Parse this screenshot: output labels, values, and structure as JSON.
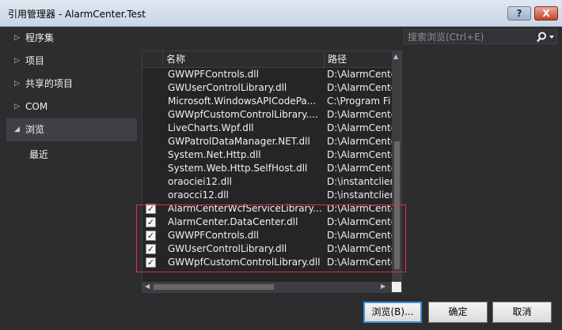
{
  "window": {
    "title": "引用管理器 - AlarmCenter.Test",
    "help_label": "?",
    "close_label": "X"
  },
  "nav": {
    "items": [
      {
        "label": "程序集",
        "arrow": "▷"
      },
      {
        "label": "项目",
        "arrow": "▷"
      },
      {
        "label": "共享的项目",
        "arrow": "▷"
      },
      {
        "label": "COM",
        "arrow": "▷"
      },
      {
        "label": "浏览",
        "arrow": "◢"
      }
    ],
    "sub_item": "最近"
  },
  "search": {
    "placeholder": "搜索浏览(Ctrl+E)",
    "icon": "search-icon"
  },
  "list": {
    "columns": [
      "名称",
      "路径"
    ],
    "rows": [
      {
        "name": "GWWPFControls.dll",
        "path": "D:\\AlarmCente",
        "checked": false
      },
      {
        "name": "GWUserControlLibrary.dll",
        "path": "D:\\AlarmCente",
        "checked": false
      },
      {
        "name": "Microsoft.WindowsAPICodePa...",
        "path": "C:\\Program Fi",
        "checked": false
      },
      {
        "name": "GWWpfCustomControlLibrary....",
        "path": "D:\\AlarmCente",
        "checked": false
      },
      {
        "name": "LiveCharts.Wpf.dll",
        "path": "D:\\AlarmCente",
        "checked": false
      },
      {
        "name": "GWPatrolDataManager.NET.dll",
        "path": "D:\\AlarmCente",
        "checked": false
      },
      {
        "name": "System.Net.Http.dll",
        "path": "D:\\AlarmCente",
        "checked": false
      },
      {
        "name": "System.Web.Http.SelfHost.dll",
        "path": "D:\\AlarmCente",
        "checked": false
      },
      {
        "name": "oraociei12.dll",
        "path": "D:\\instantclien",
        "checked": false
      },
      {
        "name": "oraocci12.dll",
        "path": "D:\\instantclien",
        "checked": false
      },
      {
        "name": "AlarmCenterWcfServiceLibrary....",
        "path": "D:\\AlarmCente",
        "checked": true
      },
      {
        "name": "AlarmCenter.DataCenter.dll",
        "path": "D:\\AlarmCente",
        "checked": true
      },
      {
        "name": "GWWPFControls.dll",
        "path": "D:\\AlarmCente",
        "checked": true
      },
      {
        "name": "GWUserControlLibrary.dll",
        "path": "D:\\AlarmCente",
        "checked": true
      },
      {
        "name": "GWWpfCustomControlLibrary.dll",
        "path": "D:\\AlarmCente",
        "checked": true
      }
    ]
  },
  "buttons": {
    "browse": "浏览(B)...",
    "ok": "确定",
    "cancel": "取消"
  },
  "colors": {
    "background": "#2d2d30",
    "highlight_border": "#e0303a",
    "accent": "#3a8fd8"
  }
}
